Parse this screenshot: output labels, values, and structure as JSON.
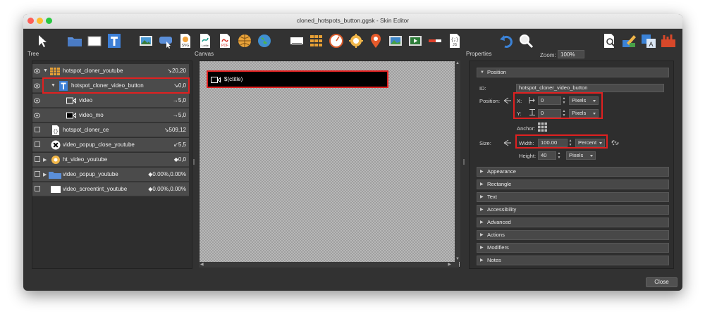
{
  "window": {
    "title": "cloned_hotspots_button.ggsk - Skin Editor",
    "colors": {
      "close": "#fe5f57",
      "minimize": "#febc2e",
      "zoom": "#28c840",
      "highlight": "#e02020"
    }
  },
  "toolbar": {
    "tools": [
      {
        "icon": "pointer-icon"
      },
      {
        "icon": "folder-icon"
      },
      {
        "icon": "rectangle-icon"
      },
      {
        "icon": "text-icon"
      },
      {
        "icon": "image-icon"
      },
      {
        "icon": "image-button-icon"
      },
      {
        "icon": "svg-file-icon",
        "label": "SVG"
      },
      {
        "icon": "lottie-file-icon",
        "label": "Lottie"
      },
      {
        "icon": "pdf-file-icon",
        "label": "PDF"
      },
      {
        "icon": "globe-icon"
      },
      {
        "icon": "map-icon"
      },
      {
        "icon": "container-icon"
      },
      {
        "icon": "cloner-icon"
      },
      {
        "icon": "compass-icon"
      },
      {
        "icon": "hotspot-icon"
      },
      {
        "icon": "map-pin-icon"
      },
      {
        "icon": "thumbnail-icon"
      },
      {
        "icon": "video-icon"
      },
      {
        "icon": "progress-bar-icon"
      },
      {
        "icon": "code-file-icon",
        "label": "JS"
      },
      {
        "icon": "undo-icon"
      },
      {
        "icon": "zoom-tool-icon"
      }
    ],
    "zoom_label": "Zoom:",
    "zoom_value": "100%",
    "right_tools": [
      {
        "icon": "preview-icon"
      },
      {
        "icon": "edit-icon"
      },
      {
        "icon": "translate-icon",
        "label": "A"
      },
      {
        "icon": "toolbox-icon"
      }
    ]
  },
  "tree": {
    "header": "Tree",
    "rows": [
      {
        "label": "hotspot_cloner_youtube",
        "pos": "↘20,20",
        "visible": true,
        "expanded": true,
        "icon": "cloner-icon"
      },
      {
        "label": "hotspot_cloner_video_button",
        "pos": "↘0,0",
        "visible": true,
        "expanded": true,
        "icon": "text-icon"
      },
      {
        "label": "video",
        "pos": "→5,0",
        "visible": true,
        "icon": "video-camera-icon"
      },
      {
        "label": "video_mo",
        "pos": "→5,0",
        "visible": true,
        "icon": "video-camera-icon"
      },
      {
        "label": "hotspot_cloner_ce",
        "pos": "↘509,12",
        "visible": false,
        "icon": "code-icon"
      },
      {
        "label": "video_popup_close_youtube",
        "pos": "↙5,5",
        "visible": false,
        "icon": "close-circle-icon"
      },
      {
        "label": "ht_video_youtube",
        "pos": "◆0,0",
        "visible": false,
        "collapsed": true,
        "icon": "hotspot-icon"
      },
      {
        "label": "video_popup_youtube",
        "pos": "◆0.00%,0.00%",
        "visible": false,
        "collapsed": true,
        "icon": "folder-icon"
      },
      {
        "label": "video_screentint_youtube",
        "pos": "◆0.00%,0.00%",
        "visible": false,
        "icon": "rectangle-icon"
      }
    ]
  },
  "canvas": {
    "header": "Canvas",
    "button_text": "$(ctitle)"
  },
  "properties": {
    "header": "Properties",
    "position_section": "Position",
    "id_label": "ID:",
    "id_value": "hotspot_cloner_video_button",
    "position_label": "Position:",
    "x_label": "X:",
    "x_value": "0",
    "x_unit": "Pixels",
    "y_label": "Y:",
    "y_value": "0",
    "y_unit": "Pixels",
    "anchor_label": "Anchor:",
    "size_label": "Size:",
    "width_label": "Width:",
    "width_value": "100.00",
    "width_unit": "Percent",
    "height_label": "Height:",
    "height_value": "40",
    "height_unit": "Pixels",
    "sections": [
      "Appearance",
      "Rectangle",
      "Text",
      "Accessibility",
      "Advanced",
      "Actions",
      "Modifiers",
      "Notes"
    ]
  },
  "footer": {
    "close_label": "Close"
  }
}
